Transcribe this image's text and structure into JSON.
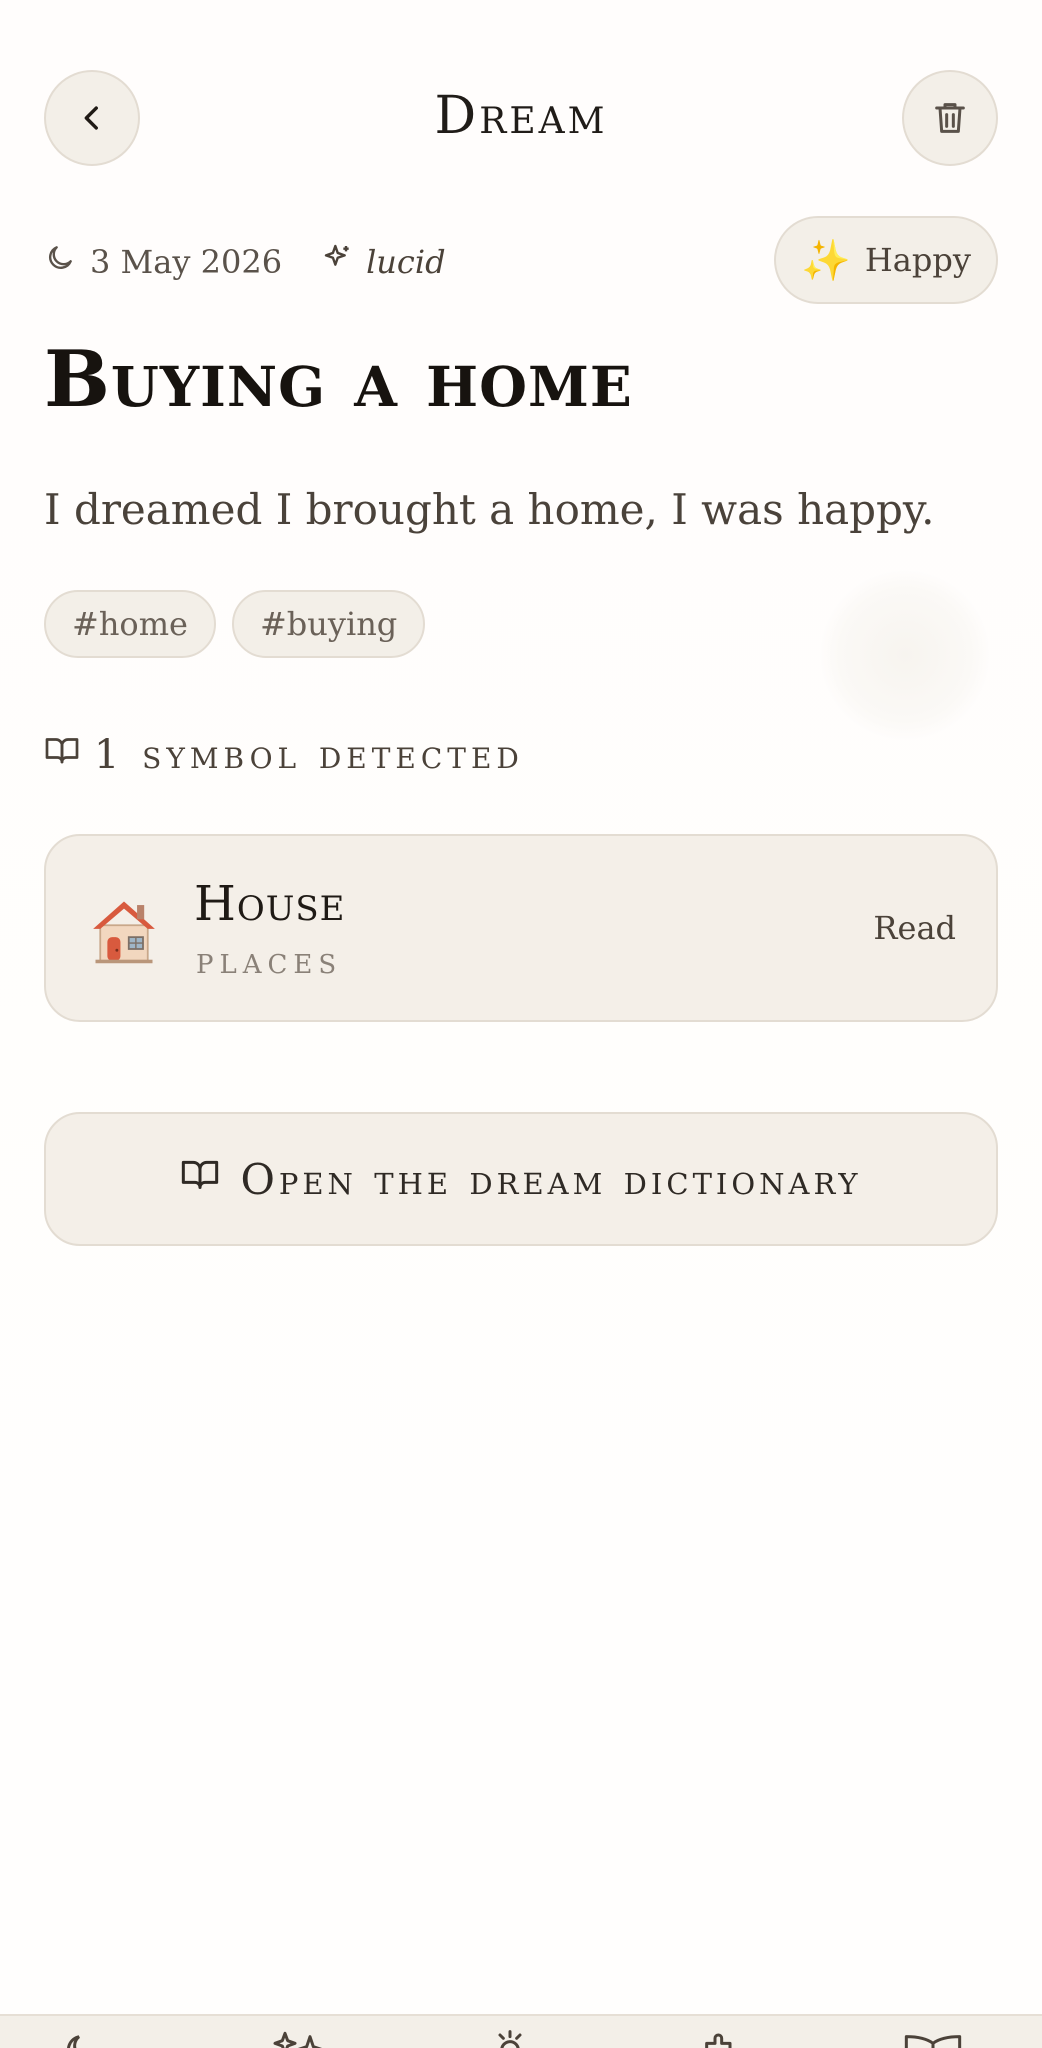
{
  "header": {
    "title": "Dream",
    "back_icon": "chevron-left-icon",
    "delete_icon": "trash-icon"
  },
  "meta": {
    "date": "3 May 2026",
    "date_icon": "moon-icon",
    "lucid_label": "lucid",
    "lucid_icon": "sparkle-icon"
  },
  "mood": {
    "emoji": "✨",
    "label": "Happy"
  },
  "dream": {
    "title": "Buying a home",
    "text": "I dreamed I brought a home, I was happy."
  },
  "tags": [
    "#home",
    "#buying"
  ],
  "symbols": {
    "heading": "1 symbol detected",
    "heading_icon": "book-icon",
    "items": [
      {
        "icon": "house-icon",
        "name": "House",
        "category": "PLACES",
        "action": "Read"
      }
    ]
  },
  "dictionary_button": {
    "label": "Open the dream dictionary",
    "icon": "book-icon"
  },
  "bottom_nav": {
    "items": [
      "moon-icon",
      "sparkles-icon",
      "sun-icon",
      "puzzle-icon",
      "book-open-icon"
    ]
  },
  "colors": {
    "background": "#fffdfc",
    "surface": "#f4efe8",
    "border": "#e3dcd2",
    "text_primary": "#17130f",
    "text_secondary": "#4b4239",
    "text_muted": "#8a8178"
  }
}
